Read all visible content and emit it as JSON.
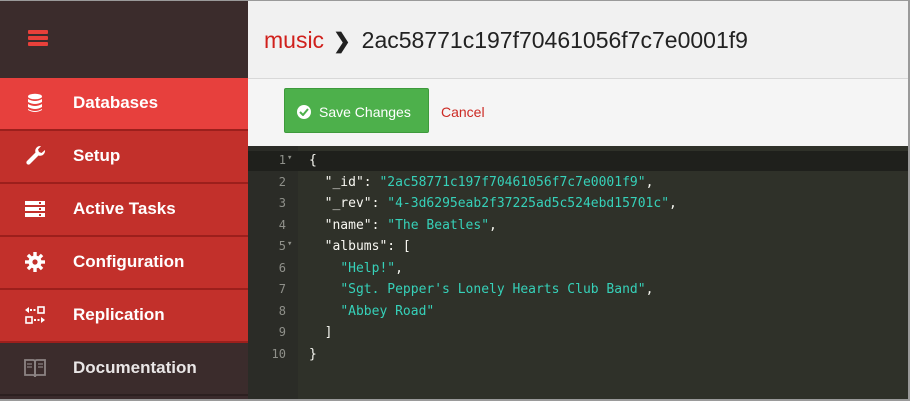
{
  "sidebar": {
    "items": [
      {
        "label": "Databases",
        "icon": "database-icon",
        "active": true
      },
      {
        "label": "Setup",
        "icon": "wrench-icon"
      },
      {
        "label": "Active Tasks",
        "icon": "tasks-icon"
      },
      {
        "label": "Configuration",
        "icon": "gear-icon"
      },
      {
        "label": "Replication",
        "icon": "replication-icon"
      },
      {
        "label": "Documentation",
        "icon": "book-icon"
      }
    ]
  },
  "header": {
    "database": "music",
    "doc_id": "2ac58771c197f70461056f7c7e0001f9"
  },
  "toolbar": {
    "save_label": "Save Changes",
    "cancel_label": "Cancel"
  },
  "editor": {
    "lines": [
      {
        "num": "1",
        "fold": true,
        "tokens": [
          {
            "t": "p",
            "v": "{"
          }
        ]
      },
      {
        "num": "2",
        "tokens": [
          {
            "t": "p",
            "v": "  "
          },
          {
            "t": "k",
            "v": "\"_id\""
          },
          {
            "t": "p",
            "v": ": "
          },
          {
            "t": "s",
            "v": "\"2ac58771c197f70461056f7c7e0001f9\""
          },
          {
            "t": "p",
            "v": ","
          }
        ]
      },
      {
        "num": "3",
        "tokens": [
          {
            "t": "p",
            "v": "  "
          },
          {
            "t": "k",
            "v": "\"_rev\""
          },
          {
            "t": "p",
            "v": ": "
          },
          {
            "t": "s",
            "v": "\"4-3d6295eab2f37225ad5c524ebd15701c\""
          },
          {
            "t": "p",
            "v": ","
          }
        ]
      },
      {
        "num": "4",
        "tokens": [
          {
            "t": "p",
            "v": "  "
          },
          {
            "t": "k",
            "v": "\"name\""
          },
          {
            "t": "p",
            "v": ": "
          },
          {
            "t": "s",
            "v": "\"The Beatles\""
          },
          {
            "t": "p",
            "v": ","
          }
        ]
      },
      {
        "num": "5",
        "fold": true,
        "tokens": [
          {
            "t": "p",
            "v": "  "
          },
          {
            "t": "k",
            "v": "\"albums\""
          },
          {
            "t": "p",
            "v": ": ["
          }
        ]
      },
      {
        "num": "6",
        "tokens": [
          {
            "t": "p",
            "v": "    "
          },
          {
            "t": "s",
            "v": "\"Help!\""
          },
          {
            "t": "p",
            "v": ","
          }
        ]
      },
      {
        "num": "7",
        "tokens": [
          {
            "t": "p",
            "v": "    "
          },
          {
            "t": "s",
            "v": "\"Sgt. Pepper's Lonely Hearts Club Band\""
          },
          {
            "t": "p",
            "v": ","
          }
        ]
      },
      {
        "num": "8",
        "tokens": [
          {
            "t": "p",
            "v": "    "
          },
          {
            "t": "s",
            "v": "\"Abbey Road\""
          }
        ]
      },
      {
        "num": "9",
        "tokens": [
          {
            "t": "p",
            "v": "  ]"
          }
        ]
      },
      {
        "num": "10",
        "tokens": [
          {
            "t": "p",
            "v": "}"
          }
        ]
      }
    ]
  },
  "colors": {
    "brand_red": "#e7403d",
    "sidebar_red": "#c2302b",
    "sidebar_dark": "#3b2c2c",
    "save_green": "#4db04b",
    "editor_bg": "#2f3129",
    "string_color": "#36d1b9"
  }
}
